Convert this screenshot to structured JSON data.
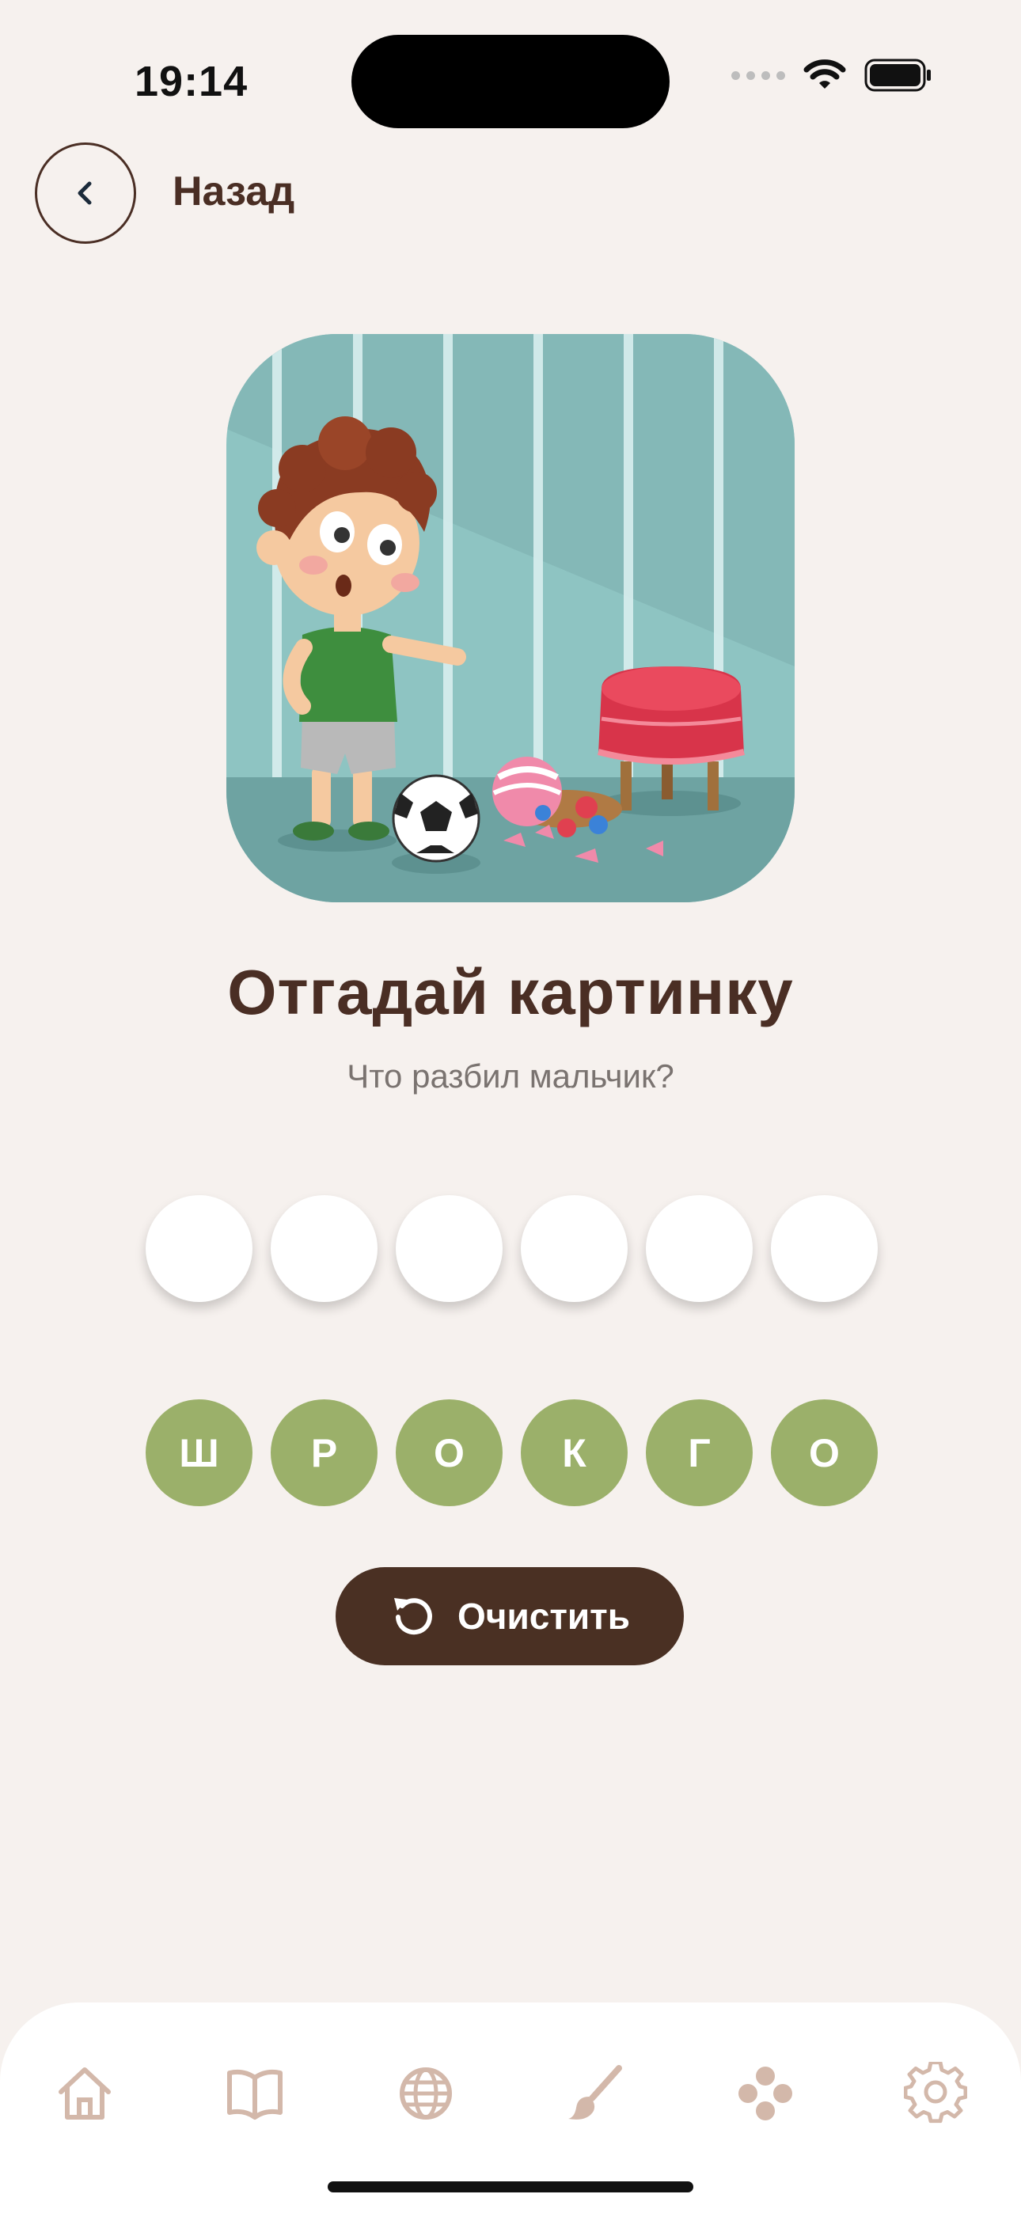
{
  "status_bar": {
    "time": "19:14"
  },
  "header": {
    "back_label": "Назад",
    "back_icon": "chevron-left-icon"
  },
  "puzzle": {
    "title": "Отгадай картинку",
    "question": "Что разбил мальчик?",
    "answer_slots": [
      "",
      "",
      "",
      "",
      "",
      ""
    ],
    "letters": [
      "Ш",
      "Р",
      "О",
      "К",
      "Г",
      "О"
    ]
  },
  "actions": {
    "clear_label": "Очистить",
    "clear_icon": "reset-icon"
  },
  "tab_bar": {
    "items": [
      "home-icon",
      "book-icon",
      "globe-icon",
      "paintbrush-icon",
      "gamepad-icon",
      "gear-icon"
    ]
  },
  "colors": {
    "background": "#f6f1ee",
    "primary_text": "#4a2e24",
    "letter_tile": "#9bb06a",
    "clear_button": "#4a3023",
    "tab_icon": "#d3b8aa"
  }
}
